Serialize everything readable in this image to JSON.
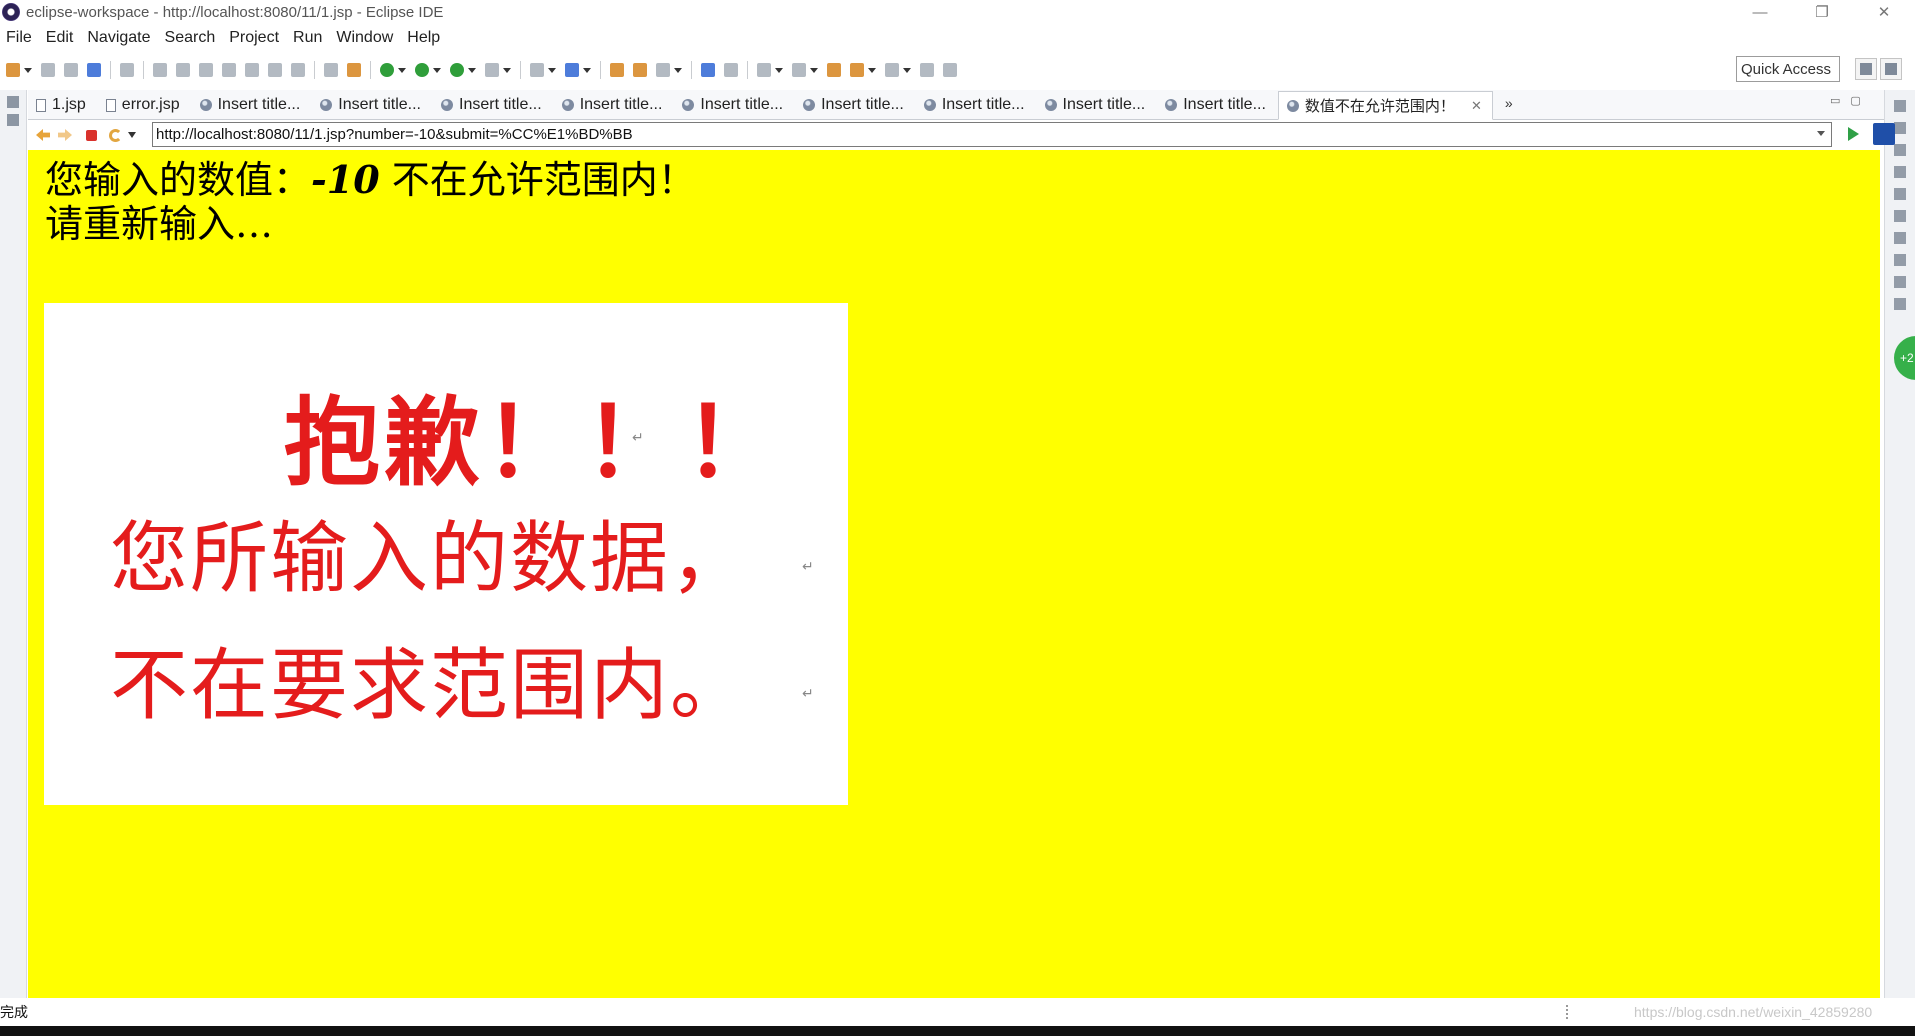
{
  "window": {
    "title": "eclipse-workspace - http://localhost:8080/11/1.jsp - Eclipse IDE",
    "minimize": "—",
    "restore": "❐",
    "close": "✕"
  },
  "menu": [
    "File",
    "Edit",
    "Navigate",
    "Search",
    "Project",
    "Run",
    "Window",
    "Help"
  ],
  "toolbar": {
    "quick_access": "Quick Access"
  },
  "tabs": [
    {
      "label": "1.jsp",
      "icon": "doc-icon"
    },
    {
      "label": "error.jsp",
      "icon": "doc-icon"
    },
    {
      "label": "Insert title...",
      "icon": "globe-icon"
    },
    {
      "label": "Insert title...",
      "icon": "globe-icon"
    },
    {
      "label": "Insert title...",
      "icon": "globe-icon"
    },
    {
      "label": "Insert title...",
      "icon": "globe-icon"
    },
    {
      "label": "Insert title...",
      "icon": "globe-icon"
    },
    {
      "label": "Insert title...",
      "icon": "globe-icon"
    },
    {
      "label": "Insert title...",
      "icon": "globe-icon"
    },
    {
      "label": "Insert title...",
      "icon": "globe-icon"
    },
    {
      "label": "Insert title...",
      "icon": "globe-icon"
    },
    {
      "label": "数值不在允许范围内！",
      "icon": "globe-icon",
      "active": true
    }
  ],
  "tab_overflow": "»",
  "tab_close": "✕",
  "browser": {
    "url": "http://localhost:8080/11/1.jsp?number=-10&submit=%CC%E1%BD%BB"
  },
  "page": {
    "line1_prefix": "您输入的数值：",
    "line1_value": "-10",
    "line1_suffix": " 不在允许范围内！",
    "line2": "请重新输入…",
    "image": {
      "title": "抱歉！！！",
      "line1": "您所输入的数据，",
      "line2": "不在要求范围内。",
      "para_mark": "↵"
    }
  },
  "status": {
    "text": "完成",
    "watermark": "https://blog.csdn.net/weixin_42859280"
  },
  "side_badge": "+2",
  "colors": {
    "page_bg": "#ffff00",
    "sorry_red": "#e41c1c"
  }
}
